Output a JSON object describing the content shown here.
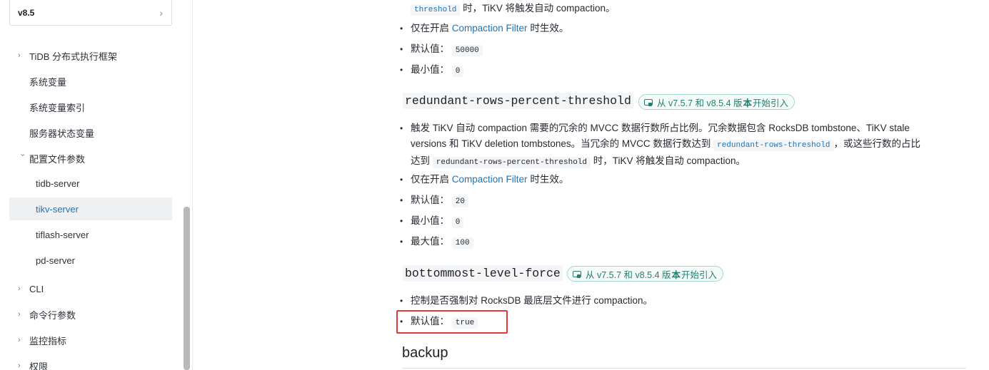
{
  "sidebar": {
    "version": "v8.5",
    "items": [
      {
        "label": "TiDB 分布式执行框架",
        "arrow": "›"
      },
      {
        "label": "系统变量"
      },
      {
        "label": "系统变量索引"
      },
      {
        "label": "服务器状态变量"
      },
      {
        "label": "配置文件参数",
        "arrow": "›"
      },
      {
        "label": "tidb-server"
      },
      {
        "label": "tikv-server"
      },
      {
        "label": "tiflash-server"
      },
      {
        "label": "pd-server"
      },
      {
        "label": "CLI",
        "arrow": "›"
      },
      {
        "label": "命令行参数",
        "arrow": "›"
      },
      {
        "label": "监控指标",
        "arrow": "›"
      },
      {
        "label": "权限",
        "arrow": "›"
      }
    ]
  },
  "content": {
    "top": {
      "code": "threshold",
      "text": " 时，TiKV 将触发自动 compaction。",
      "b1_pre": "仅在开启 ",
      "b1_link": "Compaction Filter",
      "b1_post": " 时生效。",
      "b2_label": "默认值：",
      "b2_value": "50000",
      "b3_label": "最小值：",
      "b3_value": "0"
    },
    "section1": {
      "title": "redundant-rows-percent-threshold",
      "badge_pre": "从 v7.5.7 和 v8.5.4 版",
      "badge_bold": "本",
      "badge_post": "开始引入",
      "desc_line1": "触发 TiKV 自动 compaction 需要的冗余的 MVCC 数据行数所占比例。冗余数据包含 RocksDB tombstone、TiKV stale",
      "desc_line2_pre": "versions 和 TiKV deletion tombstones。当冗余的 MVCC 数据行数达到 ",
      "desc_line2_code": "redundant-rows-threshold",
      "desc_line2_post": "，或这些行数的占比",
      "desc_line3_pre": "达到 ",
      "desc_line3_code": "redundant-rows-percent-threshold",
      "desc_line3_post": " 时，TiKV 将触发自动 compaction。",
      "b1_pre": "仅在开启 ",
      "b1_link": "Compaction Filter",
      "b1_post": " 时生效。",
      "default_label": "默认值：",
      "default_value": "20",
      "min_label": "最小值：",
      "min_value": "0",
      "max_label": "最大值：",
      "max_value": "100"
    },
    "section2": {
      "title": "bottommost-level-force",
      "badge_pre": "从 v7.5.7 和 v8.5.4 版",
      "badge_bold": "本",
      "badge_post": "开始引入",
      "desc": "控制是否强制对 RocksDB 最底层文件进行 compaction。",
      "default_label": "默认值：",
      "default_value": "true"
    },
    "section3": {
      "title": "backup"
    }
  },
  "colors": {
    "link": "#1f73b7",
    "badge": "#23806f",
    "highlight": "#e53935"
  }
}
